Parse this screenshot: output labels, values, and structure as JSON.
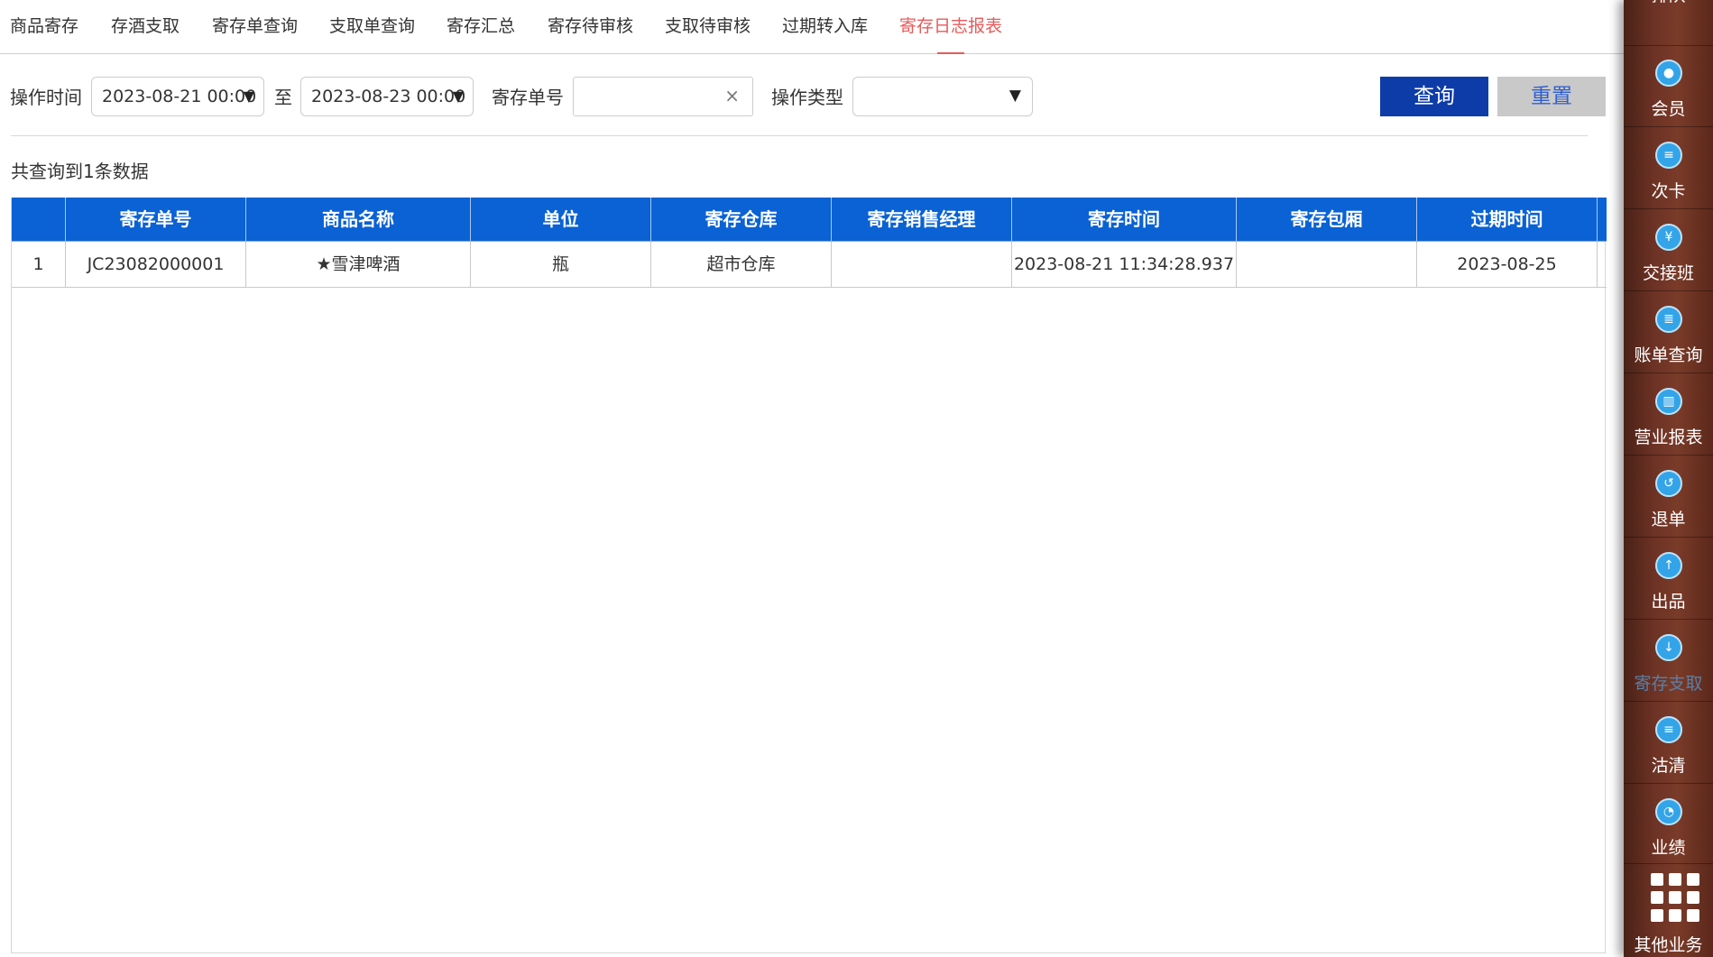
{
  "tabs": [
    {
      "label": "商品寄存"
    },
    {
      "label": "存酒支取"
    },
    {
      "label": "寄存单查询"
    },
    {
      "label": "支取单查询"
    },
    {
      "label": "寄存汇总"
    },
    {
      "label": "寄存待审核"
    },
    {
      "label": "支取待审核"
    },
    {
      "label": "过期转入库"
    },
    {
      "label": "寄存日志报表"
    }
  ],
  "active_tab": "寄存日志报表",
  "filters": {
    "op_time_label": "操作时间",
    "start_date": "2023-08-21 00:00",
    "to_label": "至",
    "end_date": "2023-08-23 00:00",
    "deposit_no_label": "寄存单号",
    "deposit_no_value": "",
    "clear_glyph": "×",
    "op_type_label": "操作类型",
    "op_type_value": "",
    "dropdown_glyph": "▼"
  },
  "buttons": {
    "query": "查询",
    "reset": "重置"
  },
  "result_count": "共查询到1条数据",
  "table": {
    "headers": [
      "",
      "寄存单号",
      "商品名称",
      "单位",
      "寄存仓库",
      "寄存销售经理",
      "寄存时间",
      "寄存包厢",
      "过期时间"
    ],
    "rows": [
      [
        "1",
        "JC23082000001",
        "★雪津啤酒",
        "瓶",
        "超市仓库",
        "",
        "2023-08-21 11:34:28.937",
        "",
        "2023-08-25"
      ]
    ]
  },
  "sidebar": {
    "items": [
      {
        "label": "排队",
        "icon": "queue-icon"
      },
      {
        "label": "会员",
        "icon": "member-icon"
      },
      {
        "label": "次卡",
        "icon": "card-icon"
      },
      {
        "label": "交接班",
        "icon": "handover-icon"
      },
      {
        "label": "账单查询",
        "icon": "bill-search-icon"
      },
      {
        "label": "营业报表",
        "icon": "report-icon"
      },
      {
        "label": "退单",
        "icon": "refund-icon"
      },
      {
        "label": "出品",
        "icon": "output-icon"
      },
      {
        "label": "寄存支取",
        "icon": "deposit-withdraw-icon"
      },
      {
        "label": "沽清",
        "icon": "soldout-icon"
      },
      {
        "label": "业绩",
        "icon": "performance-icon"
      }
    ],
    "active": "寄存支取",
    "other_label": "其他业务"
  },
  "colors": {
    "header_blue": "#0a62d4",
    "query_button": "#0d3ca8",
    "active_tab": "#e85a5a",
    "sidebar_brown": "#6d3325"
  }
}
